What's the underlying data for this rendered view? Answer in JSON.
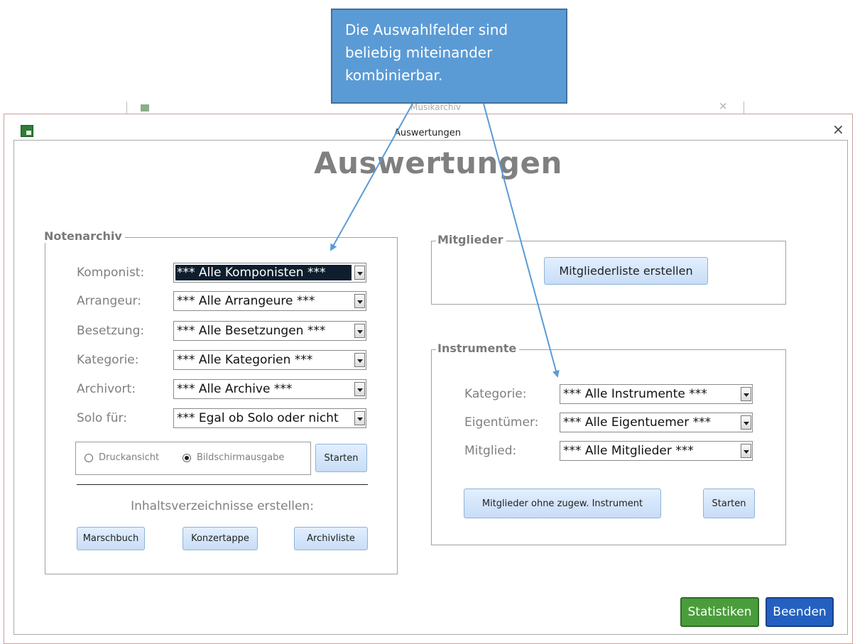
{
  "callout": {
    "text_lines": [
      "Die Auswahlfelder sind",
      "beliebig miteinander",
      "kombinierbar."
    ]
  },
  "background_window": {
    "title": "Musikarchiv",
    "close": "×"
  },
  "dialog": {
    "title": "Auswertungen",
    "close": "×",
    "heading": "Auswertungen"
  },
  "notenarchiv": {
    "label": "Notenarchiv",
    "fields": [
      {
        "label": "Komponist:",
        "value": "*** Alle Komponisten ***"
      },
      {
        "label": "Arrangeur:",
        "value": "*** Alle Arrangeure ***"
      },
      {
        "label": "Besetzung:",
        "value": "*** Alle Besetzungen ***"
      },
      {
        "label": "Kategorie:",
        "value": "*** Alle Kategorien ***"
      },
      {
        "label": "Archivort:",
        "value": "*** Alle Archive ***"
      },
      {
        "label": "Solo für:",
        "value": "*** Egal ob Solo oder nicht"
      }
    ],
    "output_options": [
      {
        "label": "Druckansicht",
        "selected": false
      },
      {
        "label": "Bildschirmausgabe",
        "selected": true
      }
    ],
    "start_button": "Starten",
    "toc_label": "Inhaltsverzeichnisse erstellen:",
    "toc_buttons": [
      "Marschbuch",
      "Konzertappe",
      "Archivliste"
    ]
  },
  "mitglieder": {
    "label": "Mitglieder",
    "button": "Mitgliederliste erstellen"
  },
  "instrumente": {
    "label": "Instrumente",
    "fields": [
      {
        "label": "Kategorie:",
        "value": "*** Alle Instrumente ***"
      },
      {
        "label": "Eigentümer:",
        "value": "*** Alle Eigentuemer ***"
      },
      {
        "label": "Mitglied:",
        "value": "*** Alle Mitglieder ***"
      }
    ],
    "no_instrument_button": "Mitglieder ohne zugew. Instrument",
    "start_button": "Starten"
  },
  "footer": {
    "stats_button": "Statistiken",
    "exit_button": "Beenden"
  },
  "colors": {
    "callout_fill": "#5b9bd5",
    "stats_green": "#4a9d3b",
    "exit_blue": "#2460c0",
    "button_light_blue": "#c8ddf6"
  }
}
